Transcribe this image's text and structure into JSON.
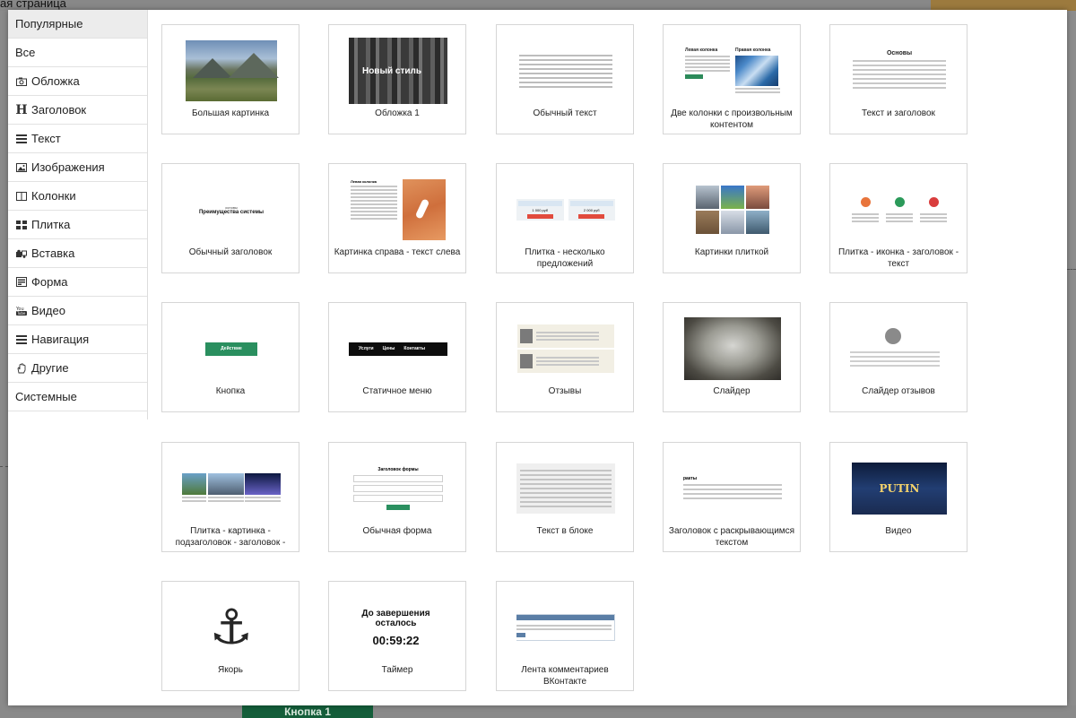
{
  "background": {
    "top_title": "ая страница",
    "bottom_button": "Кнопка 1"
  },
  "sidebar": {
    "items": [
      {
        "label": "Популярные",
        "icon": "",
        "active": true
      },
      {
        "label": "Все",
        "icon": ""
      },
      {
        "label": "Обложка",
        "icon": "camera-icon"
      },
      {
        "label": "Заголовок",
        "icon": "heading-icon"
      },
      {
        "label": "Текст",
        "icon": "text-lines-icon"
      },
      {
        "label": "Изображения",
        "icon": "image-icon"
      },
      {
        "label": "Колонки",
        "icon": "columns-icon"
      },
      {
        "label": "Плитка",
        "icon": "tiles-icon"
      },
      {
        "label": "Вставка",
        "icon": "puzzle-icon"
      },
      {
        "label": "Форма",
        "icon": "form-icon"
      },
      {
        "label": "Видео",
        "icon": "youtube-icon"
      },
      {
        "label": "Навигация",
        "icon": "menu-icon"
      },
      {
        "label": "Другие",
        "icon": "hand-icon"
      },
      {
        "label": "Системные",
        "icon": ""
      }
    ]
  },
  "blocks": [
    {
      "label": "Большая картинка"
    },
    {
      "label": "Обложка 1",
      "thumb_text": "Новый стиль"
    },
    {
      "label": "Обычный текст"
    },
    {
      "label": "Две колонки с произвольным контентом",
      "thumb_left": "Левая колонка",
      "thumb_right": "Правая колонка"
    },
    {
      "label": "Текст и заголовок",
      "thumb_title": "Основы"
    },
    {
      "label": "Обычный заголовок",
      "thumb_small": "основы",
      "thumb_title": "Преимущества системы"
    },
    {
      "label": "Картинка справа - текст слева",
      "thumb_title": "Левая колонка"
    },
    {
      "label": "Плитка - несколько предложений",
      "thumb_price_1": "1 000 руб",
      "thumb_price_2": "2 000 руб"
    },
    {
      "label": "Картинки плиткой"
    },
    {
      "label": "Плитка - иконка - заголовок - текст"
    },
    {
      "label": "Кнопка",
      "thumb_button": "Действие"
    },
    {
      "label": "Статичное меню",
      "thumb_menu": [
        "Услуги",
        "Цены",
        "Контакты"
      ]
    },
    {
      "label": "Отзывы"
    },
    {
      "label": "Слайдер"
    },
    {
      "label": "Слайдер отзывов"
    },
    {
      "label": "Плитка - картинка - подзаголовок - заголовок -"
    },
    {
      "label": "Обычная форма",
      "thumb_title": "Заголовок формы"
    },
    {
      "label": "Текст в блоке"
    },
    {
      "label": "Заголовок с раскрывающимся текстом",
      "thumb_title": "ракты"
    },
    {
      "label": "Видео",
      "thumb_text": "PUTIN"
    },
    {
      "label": "Якорь"
    },
    {
      "label": "Таймер",
      "thumb_title": "До завершения осталось",
      "thumb_time": "00:59:22"
    },
    {
      "label": "Лента комментариев ВКонтакте"
    }
  ]
}
